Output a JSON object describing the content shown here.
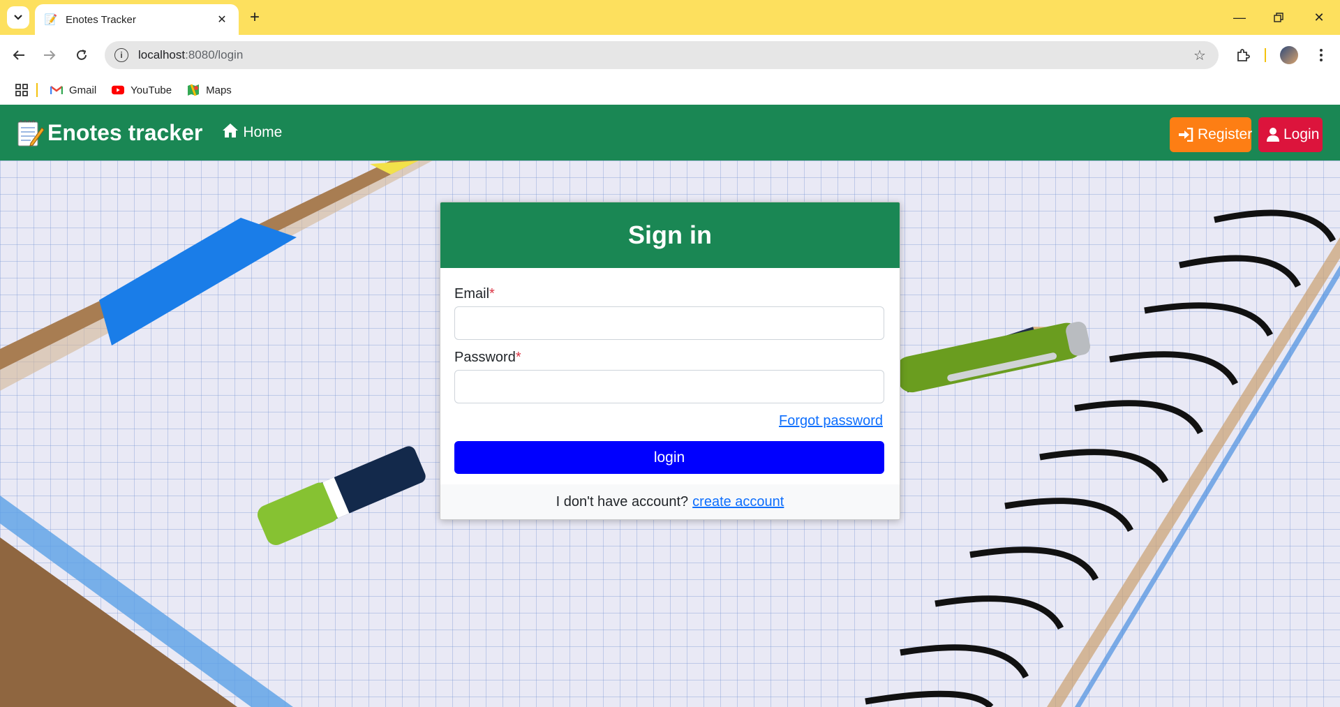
{
  "browser": {
    "tab_title": "Enotes Tracker",
    "url_host": "localhost",
    "url_path": ":8080/login",
    "bookmarks": [
      {
        "label": "Gmail",
        "icon": "gmail-icon"
      },
      {
        "label": "YouTube",
        "icon": "youtube-icon"
      },
      {
        "label": "Maps",
        "icon": "maps-icon"
      }
    ]
  },
  "nav": {
    "brand": "Enotes tracker",
    "home": "Home",
    "register": "Register",
    "login": "Login"
  },
  "signin": {
    "title": "Sign in",
    "email_label": "Email",
    "password_label": "Password",
    "required_mark": "*",
    "email_value": "",
    "password_value": "",
    "forgot": "Forgot password",
    "submit": "login",
    "footer_text": "I don't have account?",
    "footer_link": "create account"
  },
  "colors": {
    "navbar": "#1a8754",
    "register_button": "#fd7e14",
    "login_button": "#dc143c",
    "submit_button": "#0000ff",
    "link": "#0d6efd",
    "tabbar": "#fde05e"
  }
}
